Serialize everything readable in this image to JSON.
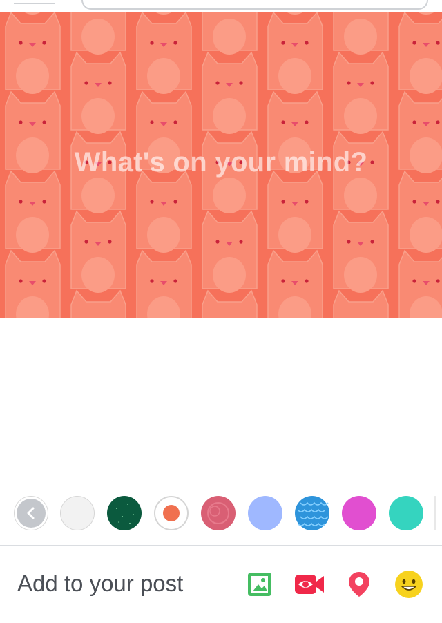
{
  "composer": {
    "prompt": "What's on your mind?",
    "background": {
      "pattern": "cat-pattern",
      "base_color": "#f6715a",
      "cat_color": "#f98a73"
    }
  },
  "backgrounds": {
    "back_icon": "chevron-left-icon",
    "swatches": [
      {
        "name": "white",
        "color": "#f2f2f2"
      },
      {
        "name": "dark-green",
        "color": "#0b5a3e"
      },
      {
        "name": "orange-cat",
        "color": "#f0704f",
        "selected": true
      },
      {
        "name": "pink",
        "color": "#d95f74"
      },
      {
        "name": "light-blue",
        "color": "#9fb8ff"
      },
      {
        "name": "blue-knit",
        "color": "#2e94db"
      },
      {
        "name": "magenta",
        "color": "#e14fd0"
      },
      {
        "name": "teal",
        "color": "#35d4bf"
      }
    ]
  },
  "footer": {
    "label": "Add to your post",
    "actions": [
      {
        "icon": "photo-icon",
        "color": "#45bd62"
      },
      {
        "icon": "live-video-icon",
        "color": "#f02849"
      },
      {
        "icon": "location-pin-icon",
        "color": "#f3425f"
      },
      {
        "icon": "emoji-icon",
        "color": "#f7d21e"
      }
    ]
  }
}
